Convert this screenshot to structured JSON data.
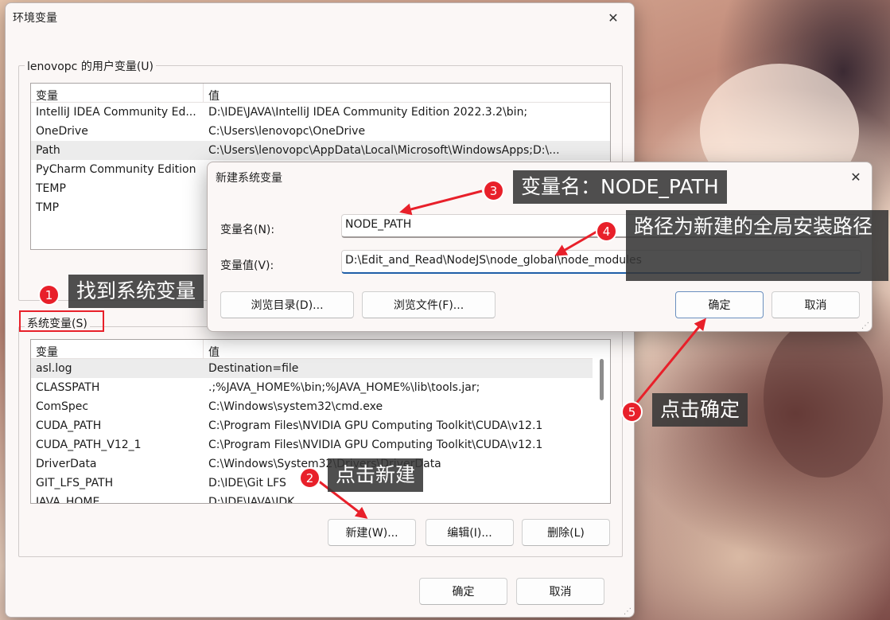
{
  "main_window": {
    "title": "环境变量",
    "close_glyph": "✕",
    "user_group_label": "lenovopc 的用户变量(U)",
    "system_group_label": "系统变量(S)",
    "columns": [
      "变量",
      "值"
    ],
    "user_vars": [
      {
        "name": "IntelliJ IDEA Community Ed...",
        "value": "D:\\IDE\\JAVA\\IntelliJ IDEA Community Edition 2022.3.2\\bin;"
      },
      {
        "name": "OneDrive",
        "value": "C:\\Users\\lenovopc\\OneDrive"
      },
      {
        "name": "Path",
        "value": "C:\\Users\\lenovopc\\AppData\\Local\\Microsoft\\WindowsApps;D:\\..."
      },
      {
        "name": "PyCharm Community Edition",
        "value": ""
      },
      {
        "name": "TEMP",
        "value": ""
      },
      {
        "name": "TMP",
        "value": ""
      }
    ],
    "system_vars": [
      {
        "name": "asl.log",
        "value": "Destination=file"
      },
      {
        "name": "CLASSPATH",
        "value": ".;%JAVA_HOME%\\bin;%JAVA_HOME%\\lib\\tools.jar;"
      },
      {
        "name": "ComSpec",
        "value": "C:\\Windows\\system32\\cmd.exe"
      },
      {
        "name": "CUDA_PATH",
        "value": "C:\\Program Files\\NVIDIA GPU Computing Toolkit\\CUDA\\v12.1"
      },
      {
        "name": "CUDA_PATH_V12_1",
        "value": "C:\\Program Files\\NVIDIA GPU Computing Toolkit\\CUDA\\v12.1"
      },
      {
        "name": "DriverData",
        "value": "C:\\Windows\\System32\\Drivers\\DriverData"
      },
      {
        "name": "GIT_LFS_PATH",
        "value": "D:\\IDE\\Git LFS"
      },
      {
        "name": "JAVA_HOME",
        "value": "D:\\IDE\\JAVA\\JDK"
      }
    ],
    "buttons": {
      "new": "新建(W)...",
      "edit": "编辑(I)...",
      "delete": "删除(L)",
      "ok": "确定",
      "cancel": "取消"
    }
  },
  "dialog": {
    "title": "新建系统变量",
    "close_glyph": "✕",
    "name_label": "变量名(N):",
    "name_value": "NODE_PATH",
    "value_label": "变量值(V):",
    "value_value": "D:\\Edit_and_Read\\NodeJS\\node_global\\node_modules",
    "buttons": {
      "browse_dir": "浏览目录(D)...",
      "browse_file": "浏览文件(F)...",
      "ok": "确定",
      "cancel": "取消"
    }
  },
  "annotations": {
    "steps": [
      {
        "num": "1",
        "text": "找到系统变量"
      },
      {
        "num": "2",
        "text": "点击新建"
      },
      {
        "num": "3",
        "text": "变量名：NODE_PATH"
      },
      {
        "num": "4",
        "text": "路径为新建的全局安装路径"
      },
      {
        "num": "5",
        "text": "点击确定"
      }
    ],
    "color": "#e8202a"
  }
}
